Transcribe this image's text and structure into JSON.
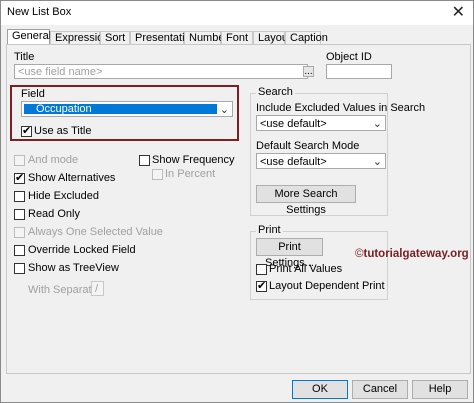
{
  "window": {
    "title": "New List Box",
    "close_glyph": "✕"
  },
  "tabs": [
    {
      "label": "General",
      "active": true
    },
    {
      "label": "Expressions"
    },
    {
      "label": "Sort"
    },
    {
      "label": "Presentation"
    },
    {
      "label": "Number"
    },
    {
      "label": "Font"
    },
    {
      "label": "Layout"
    },
    {
      "label": "Caption"
    }
  ],
  "general": {
    "title_label": "Title",
    "title_placeholder": "<use field name>",
    "title_button": "...",
    "object_id_label": "Object ID",
    "object_id_value": "",
    "field_label": "Field",
    "field_value": "Occupation",
    "use_as_title": {
      "label": "Use as Title",
      "checked": true
    },
    "options_left": [
      {
        "label": "And mode",
        "checked": false,
        "disabled": true
      },
      {
        "label": "Show Alternatives",
        "checked": true,
        "disabled": false
      },
      {
        "label": "Hide Excluded",
        "checked": false,
        "disabled": false
      },
      {
        "label": "Read Only",
        "checked": false,
        "disabled": false
      },
      {
        "label": "Always One Selected Value",
        "checked": false,
        "disabled": true
      },
      {
        "label": "Override Locked Field",
        "checked": false,
        "disabled": false
      },
      {
        "label": "Show as TreeView",
        "checked": false,
        "disabled": false
      }
    ],
    "with_separator": {
      "label": "With Separator",
      "value": "/"
    },
    "show_frequency": {
      "label": "Show Frequency",
      "checked": false
    },
    "in_percent": {
      "label": "In Percent",
      "checked": false,
      "disabled": true
    },
    "search": {
      "group_label": "Search",
      "include_excluded_label": "Include Excluded Values in Search",
      "include_excluded_value": "<use default>",
      "default_mode_label": "Default Search Mode",
      "default_mode_value": "<use default>",
      "more_settings_button": "More Search Settings"
    },
    "print": {
      "group_label": "Print",
      "print_settings_button": "Print Settings...",
      "print_all_values": {
        "label": "Print All Values",
        "checked": false
      },
      "layout_dependent": {
        "label": "Layout Dependent Print",
        "checked": true
      }
    }
  },
  "watermark": {
    "symbol": "©",
    "text": "tutorialgateway.org"
  },
  "footer": {
    "ok": "OK",
    "cancel": "Cancel",
    "help": "Help"
  },
  "colors": {
    "accent": "#0078d7",
    "highlight_box": "#7b1f23"
  }
}
